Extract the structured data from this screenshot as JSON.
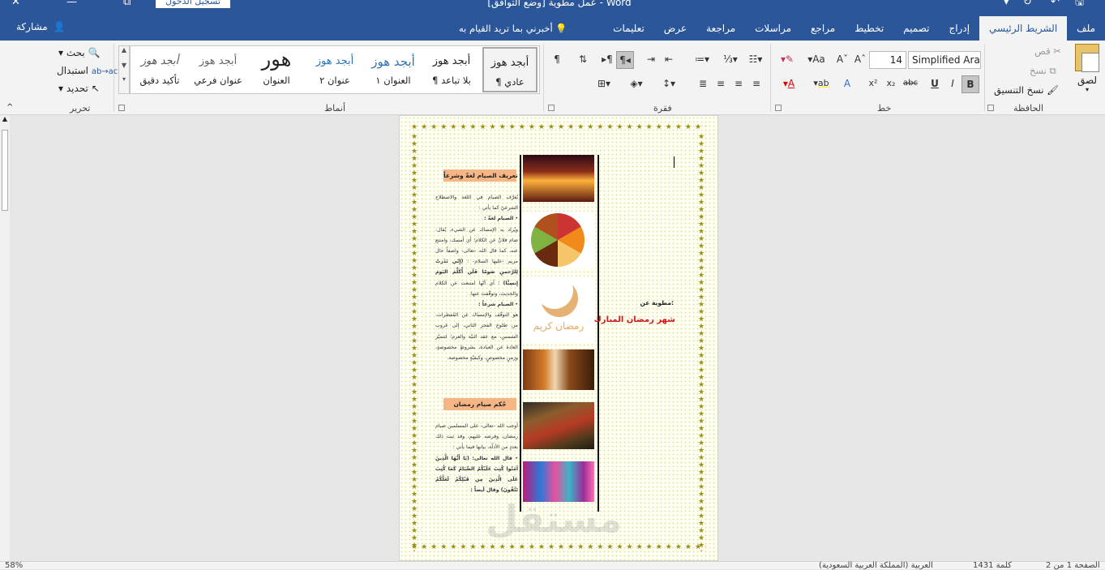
{
  "title": "عمل مطوية [وضع التوافق] - Word",
  "login_label": "تسجيل الدخول",
  "share_label": "مشاركة",
  "tell_me": "أخبرني بما تريد القيام به",
  "tabs": [
    "ملف",
    "الشريط الرئيسي",
    "إدراج",
    "تصميم",
    "تخطيط",
    "مراجع",
    "مراسلات",
    "مراجعة",
    "عرض",
    "تعليمات"
  ],
  "clipboard": {
    "label": "الحافظة",
    "paste": "لصق",
    "cut": "قص",
    "copy": "نسخ",
    "format_painter": "نسخ التنسيق"
  },
  "font": {
    "label": "خط",
    "name": "Simplified Ara",
    "size": "14"
  },
  "paragraph": {
    "label": "فقرة"
  },
  "styles": {
    "label": "أنماط",
    "items": [
      {
        "preview": "أبجد هوز",
        "name": "¶ عادي"
      },
      {
        "preview": "أبجد هوز",
        "name": "¶ بلا تباعد"
      },
      {
        "preview": "أبجد هوز",
        "name": "العنوان ١"
      },
      {
        "preview": "أبجد هوز",
        "name": "عنوان ٢"
      },
      {
        "preview": "هور",
        "name": "العنوان"
      },
      {
        "preview": "أبجد هوز",
        "name": "عنوان فرعي"
      },
      {
        "preview": "أبجد هوز",
        "name": "تأكيد دقيق"
      }
    ]
  },
  "editing": {
    "label": "تحرير",
    "find": "بحث",
    "replace": "استبدال",
    "select": "تحديد"
  },
  "doc": {
    "cover_label": "مطوية عن:",
    "cover_title": "شهر رمضان المبارك",
    "ramadan_kareem": "رمضان كريم",
    "section1_title": "تعريف الصيام لغةً وشرعاً",
    "section1_intro": "يُعرَّف الصيام في اللغة والاصطلاح الشرعيّ كما يأتي :",
    "section1_lang_head": "الصيام لغةً :",
    "section1_lang_body": "ويُراد به الإمساك عن الشيء، يُقال: صام فلانٌ عن الكلام؛ أي أمسك، وامتنع عنه، كما قال الله -تعالى- واصفاً حال مريم -عليها السلام- :",
    "section1_verse": "(إِنّي نَذَرتُ لِلرَّحمنِ صَومًا فَلَن أُكَلِّمَ اليَومَ إِنسِيًّا)",
    "section1_verse_after": "؛ أي أنّها امتنعت عن الكلام والحديث، وتوقّفت عنها.",
    "section1_shar_head": "الصيام شرعاً :",
    "section1_shar_body": "هو التوقّف والإمساك عن المُفطرات، من طلوع الفجر الثاني، إلى غروب الشمس، مع عقد النيّة والعزم؛ لتتميّز العادة عن العبادة، بشروطٍ مخصوصةٍ، وزمنٍ مخصوصٍ، وكيفيّةٍ مخصوصة.",
    "section2_title": "حُكم صيام رمضان",
    "section2_intro": "أوجب الله -تعالى- على المسلمين صيام رمضان، وفرضه عليهم، وقد ثبت ذلك بعددٍ من الأدلّة، بيانها فيما يأتي :",
    "section2_item": "قال الله تعالى: (يَا أَيُّهَا الَّذِينَ آمَنُوا كُتِبَ عَلَيْكُمُ الصِّيَامُ كَمَا كُتِبَ عَلَى الَّذِينَ مِن قَبْلِكُمْ لَعَلَّكُمْ تَتَّقُونَ) وقال أيضاً :"
  },
  "watermark": "مستقل",
  "status": {
    "zoom": "58%",
    "page": "الصفحة 1 من 2",
    "words": "1431 كلمة",
    "lang": "العربية (المملكة العربية السعودية)"
  }
}
